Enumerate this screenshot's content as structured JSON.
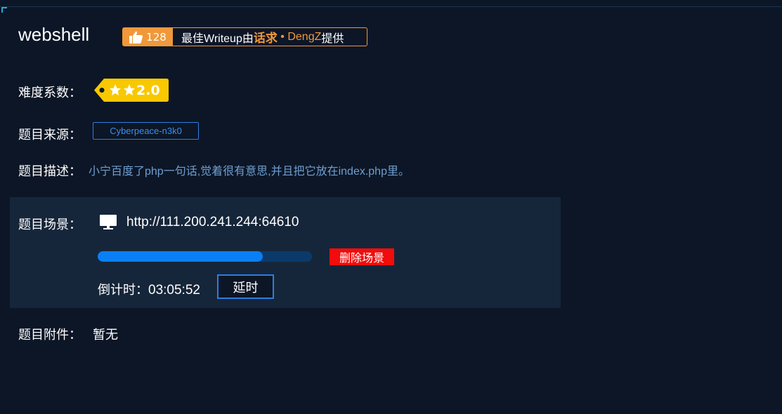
{
  "challenge": {
    "title": "webshell",
    "likes": "128",
    "writeup": {
      "prefix": "最佳Writeup由",
      "team": "话求",
      "separator": " • ",
      "author": "DengZ",
      "suffix": "提供"
    },
    "difficulty": {
      "label": "难度系数：",
      "value": "2.0",
      "stars": 2
    },
    "source": {
      "label": "题目来源：",
      "value": "Cyberpeace-n3k0"
    },
    "description": {
      "label": "题目描述：",
      "value": "小宁百度了php一句话,觉着很有意思,并且把它放在index.php里。"
    },
    "scene": {
      "label": "题目场景：",
      "url": "http://111.200.241.244:64610",
      "progress": 0.77,
      "delete_label": "删除场景",
      "countdown_label": "倒计时：",
      "countdown_time": "03:05:52",
      "extend_label": "延时"
    },
    "attachment": {
      "label": "题目附件：",
      "value": "暂无"
    }
  },
  "colors": {
    "accent": "#f0983a",
    "link": "#3a8ff0",
    "danger": "#f20c0c",
    "progress": "#0a7ff5",
    "tag": "#f9c800"
  }
}
